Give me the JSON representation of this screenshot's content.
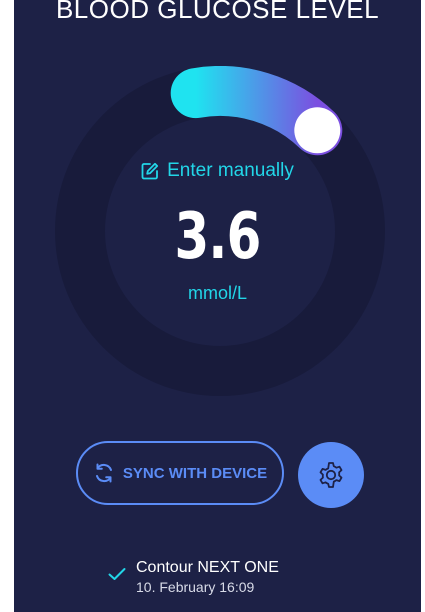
{
  "header": {
    "title": "BLOOD GLUCOSE LEVEL"
  },
  "gauge": {
    "level_fraction": 0.15,
    "colors": {
      "track_outer": "#181b3b",
      "track_inner": "#1d2146",
      "gradient_start": "#1fe3f0",
      "gradient_end": "#7b4fe0",
      "knob": "#ffffff"
    },
    "enter_manually_label": "Enter manually",
    "enter_manually_icon": "edit-icon",
    "value": "3.6",
    "unit": "mmol/L"
  },
  "actions": {
    "sync_label": "SYNC WITH DEVICE",
    "sync_icon": "sync-icon",
    "settings_icon": "gear-icon",
    "accent": "#5b8cf6"
  },
  "device": {
    "status_icon": "check-icon",
    "name": "Contour NEXT ONE",
    "last_sync": "10. February 16:09"
  }
}
